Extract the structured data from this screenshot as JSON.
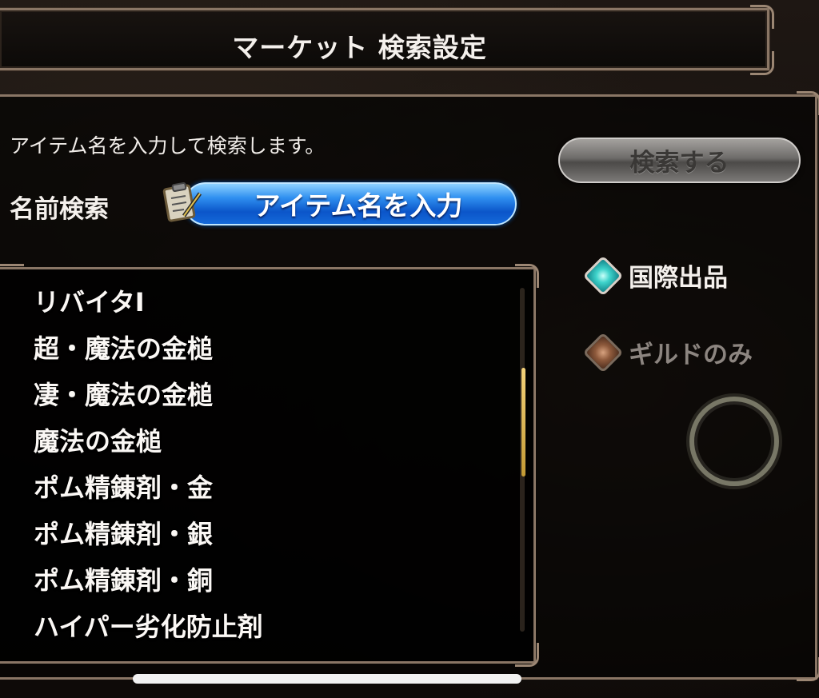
{
  "header": {
    "title": "マーケット 検索設定"
  },
  "search": {
    "instruction": "アイテム名を入力して検索します。",
    "button_label": "検索する",
    "name_label": "名前検索",
    "input_value": "アイテム名を入力"
  },
  "item_list": {
    "items": [
      "リバイタI",
      "超・魔法の金槌",
      "凄・魔法の金槌",
      "魔法の金槌",
      "ポム精錬剤・金",
      "ポム精錬剤・銀",
      "ポム精錬剤・銅",
      "ハイパー劣化防止剤"
    ]
  },
  "filters": {
    "international": {
      "label": "国際出品",
      "icon": "diamond-teal-icon",
      "selected": true
    },
    "guild_only": {
      "label": "ギルドのみ",
      "icon": "diamond-brown-icon",
      "selected": false
    }
  },
  "colors": {
    "input_blue": "#1469d8",
    "teal_diamond": "#3fd3cb",
    "frame_border": "#8a7665",
    "scroll_thumb": "#f4d27a"
  }
}
